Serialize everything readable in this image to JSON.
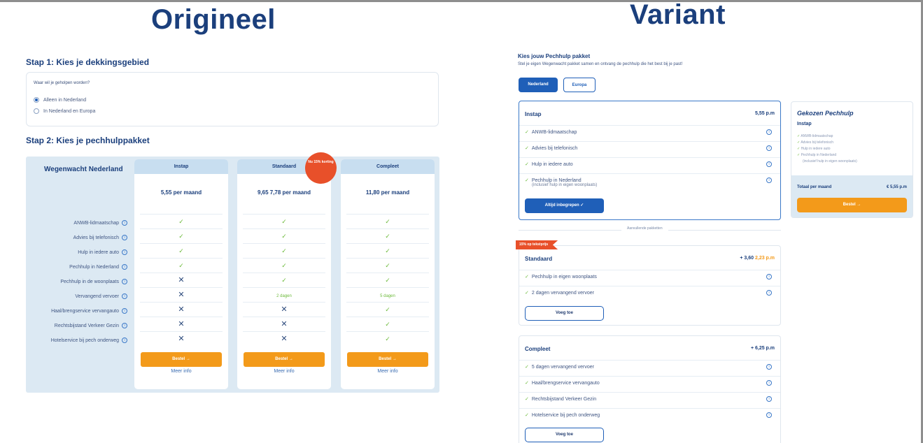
{
  "titles": {
    "original": "Origineel",
    "variant": "Variant"
  },
  "original": {
    "step1": "Stap 1: Kies je dekkingsgebied",
    "question": "Waar wil je geholpen worden?",
    "radio_options": [
      "Alleen in Nederland",
      "In Nederland en Europa"
    ],
    "step2": "Stap 2: Kies je pechhulppakket",
    "brand": "Wegenwacht Nederland",
    "rows": [
      "ANWB-lidmaatschap",
      "Advies bij telefonisch",
      "Hulp in iedere auto",
      "Pechhulp in Nederland",
      "Pechhulp in de woonplaats",
      "Vervangend vervoer",
      "Haal/brengservice vervangauto",
      "Rechtsbijstand Verkeer Gezin",
      "Hotelservice bij pech onderweg"
    ],
    "badge": "Nu 15% korting",
    "plans": [
      {
        "name": "Instap",
        "price": "5,55 per maand",
        "cells": [
          "✓",
          "✓",
          "✓",
          "✓",
          "✕",
          "✕",
          "✕",
          "✕",
          "✕"
        ],
        "button": "Bestel →",
        "more": "Meer info"
      },
      {
        "name": "Standaard",
        "price": "9,65 7,78 per maand",
        "cells": [
          "✓",
          "✓",
          "✓",
          "✓",
          "✓",
          "2 dagen",
          "✕",
          "✕",
          "✕"
        ],
        "button": "Bestel →",
        "more": "Meer info"
      },
      {
        "name": "Compleet",
        "price": "11,80 per maand",
        "cells": [
          "✓",
          "✓",
          "✓",
          "✓",
          "✓",
          "5 dagen",
          "✓",
          "✓",
          "✓"
        ],
        "button": "Bestel →",
        "more": "Meer info"
      }
    ]
  },
  "variant": {
    "title": "Kies jouw Pechhulp pakket",
    "subtitle": "Stel je eigen Wegenwacht pakket samen en ontvang de pechhulp die het best bij je past!",
    "tabs": [
      "Nederland",
      "Europa"
    ],
    "instap": {
      "name": "Instap",
      "price": "5,55 p.m",
      "features": [
        "ANWB-lidmaatschap",
        "Advies bij telefonisch",
        "Hulp in iedere auto",
        "Pechhulp in Nederland"
      ],
      "feature_sub": "(inclusief hulp in eigen woonplaats)",
      "button": "Altijd inbegrepen ✓"
    },
    "divider": "Aanvullende pakketten",
    "flag": "15% op tekstprijs",
    "standaard": {
      "name": "Standaard",
      "price_old": "+ 3,60",
      "price_new": "2,23 p.m",
      "features": [
        "Pechhulp in eigen woonplaats",
        "2 dagen vervangend vervoer"
      ],
      "button": "Voeg toe"
    },
    "compleet": {
      "name": "Compleet",
      "price": "+ 6,25 p.m",
      "features": [
        "5 dagen vervangend vervoer",
        "Haal/brengservice vervangauto",
        "Rechtsbijstand Verkeer Gezin",
        "Hotelservice bij pech onderweg"
      ],
      "button": "Voeg toe"
    },
    "summary": {
      "title": "Gekozen Pechhulp",
      "plan": "Instap",
      "features": [
        "ANWB-lidmaatschap",
        "Advies bij telefonisch",
        "Hulp in iedere auto",
        "Pechhulp in Nederland",
        "(inclusief hulp in eigen woonplaats)"
      ],
      "total_label": "Totaal per maand",
      "total_value": "€ 5,55 p.m",
      "button": "Bestel →"
    }
  }
}
